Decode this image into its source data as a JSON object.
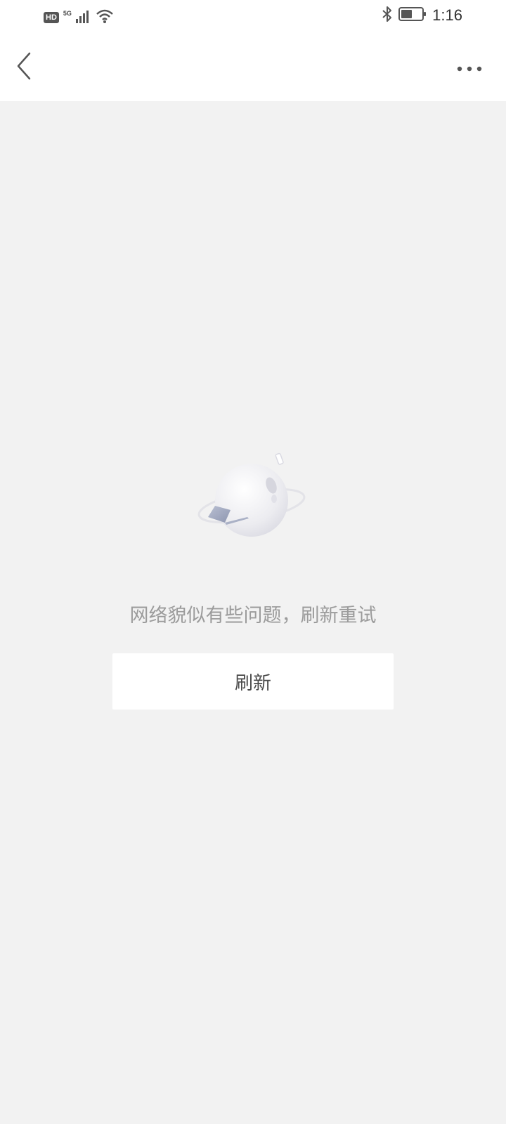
{
  "status_bar": {
    "hd_label": "HD",
    "network_label": "5G",
    "time": "1:16",
    "icons": [
      "signal-icon",
      "wifi-icon",
      "bluetooth-icon",
      "battery-icon"
    ]
  },
  "header": {
    "back_icon": "chevron-left-icon",
    "more_icon": "more-dots-icon"
  },
  "main": {
    "illustration": "planet-laptop-illustration",
    "message": "网络貌似有些问题，刷新重试",
    "refresh_label": "刷新"
  },
  "colors": {
    "page_background": "#f2f2f2",
    "bar_background": "#ffffff",
    "message_text": "#9b9b9b",
    "button_text": "#4a4a4a"
  }
}
